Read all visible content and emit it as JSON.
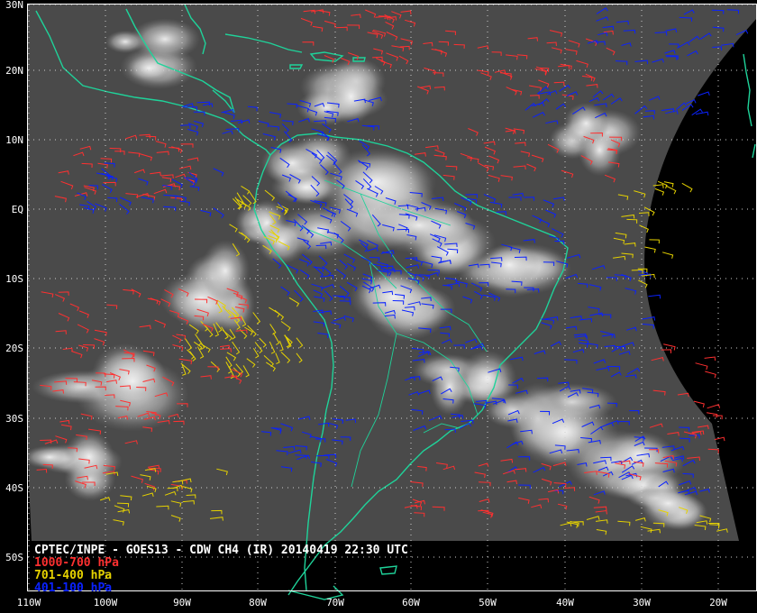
{
  "map": {
    "colors": {
      "background": "#000000",
      "coast": "#1fd39a",
      "grid": "#cfcfcf",
      "frame": "#ffffff",
      "low_level": "#ff3030",
      "mid_level": "#e6d200",
      "high_level": "#0a22ff",
      "title_text": "#ffffff"
    },
    "lat_labels": [
      "30N",
      "20N",
      "10N",
      "EQ",
      "10S",
      "20S",
      "30S",
      "40S",
      "50S"
    ],
    "lon_labels": [
      "110W",
      "100W",
      "90W",
      "80W",
      "70W",
      "60W",
      "50W",
      "40W",
      "30W",
      "20W"
    ],
    "grid_style": "dotted"
  },
  "caption": {
    "title": "CPTEC/INPE - GOES13 - CDW CH4 (IR) 20140419 22:30 UTC",
    "legend": [
      {
        "label": "1000-700 hPa",
        "color": "#ff3030"
      },
      {
        "label": "701-400 hPa",
        "color": "#e6d200"
      },
      {
        "label": "401-100 hPa",
        "color": "#0a22ff"
      }
    ]
  }
}
